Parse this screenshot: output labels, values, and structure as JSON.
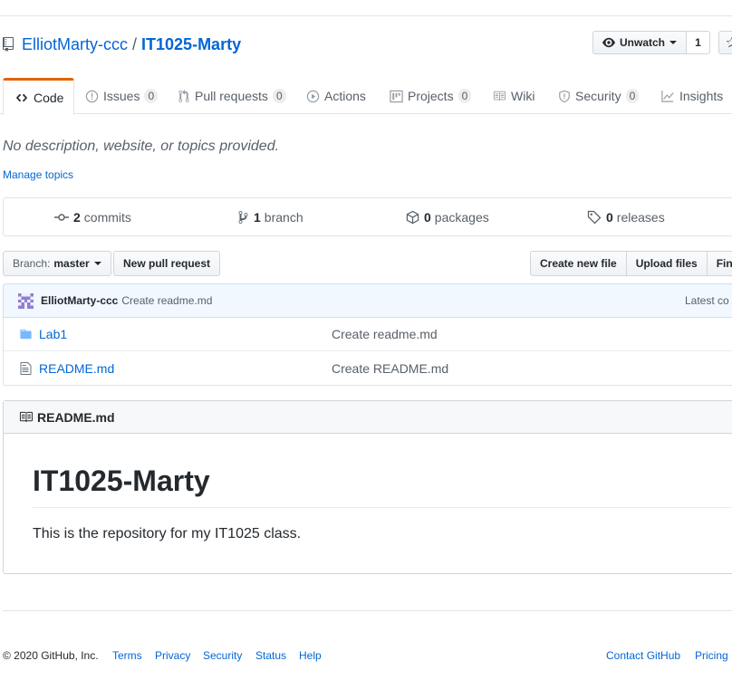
{
  "repo": {
    "owner": "ElliotMarty-ccc",
    "separator": "/",
    "name": "IT1025-Marty"
  },
  "watch": {
    "label": "Unwatch",
    "count": "1"
  },
  "tabs": [
    {
      "label": "Code",
      "icon": "code-icon",
      "counter": ""
    },
    {
      "label": "Issues",
      "icon": "issue-icon",
      "counter": "0"
    },
    {
      "label": "Pull requests",
      "icon": "pull-request-icon",
      "counter": "0"
    },
    {
      "label": "Actions",
      "icon": "play-icon",
      "counter": ""
    },
    {
      "label": "Projects",
      "icon": "project-icon",
      "counter": "0"
    },
    {
      "label": "Wiki",
      "icon": "book-icon",
      "counter": ""
    },
    {
      "label": "Security",
      "icon": "shield-icon",
      "counter": "0"
    },
    {
      "label": "Insights",
      "icon": "graph-icon",
      "counter": ""
    }
  ],
  "description": "No description, website, or topics provided.",
  "manage_topics": "Manage topics",
  "summary": {
    "commits": {
      "num": "2",
      "label": "commits"
    },
    "branch": {
      "num": "1",
      "label": "branch"
    },
    "packages": {
      "num": "0",
      "label": "packages"
    },
    "releases": {
      "num": "0",
      "label": "releases"
    }
  },
  "file_nav": {
    "branch_prefix": "Branch:",
    "branch_name": "master",
    "new_pr": "New pull request",
    "create_file": "Create new file",
    "upload_files": "Upload files",
    "find_file": "Find"
  },
  "commit_tease": {
    "author": "ElliotMarty-ccc",
    "message": "Create readme.md",
    "latest": "Latest co"
  },
  "files": [
    {
      "name": "Lab1",
      "type": "folder",
      "message": "Create readme.md"
    },
    {
      "name": "README.md",
      "type": "file",
      "message": "Create README.md"
    }
  ],
  "readme": {
    "filename": "README.md",
    "title": "IT1025-Marty",
    "body": "This is the repository for my IT1025 class."
  },
  "footer": {
    "copyright": "© 2020 GitHub, Inc.",
    "links": [
      "Terms",
      "Privacy",
      "Security",
      "Status",
      "Help"
    ],
    "right_links": [
      "Contact GitHub",
      "Pricing"
    ]
  },
  "colors": {
    "accent": "#0366d6",
    "tab_highlight": "#e36209",
    "muted": "#586069"
  }
}
